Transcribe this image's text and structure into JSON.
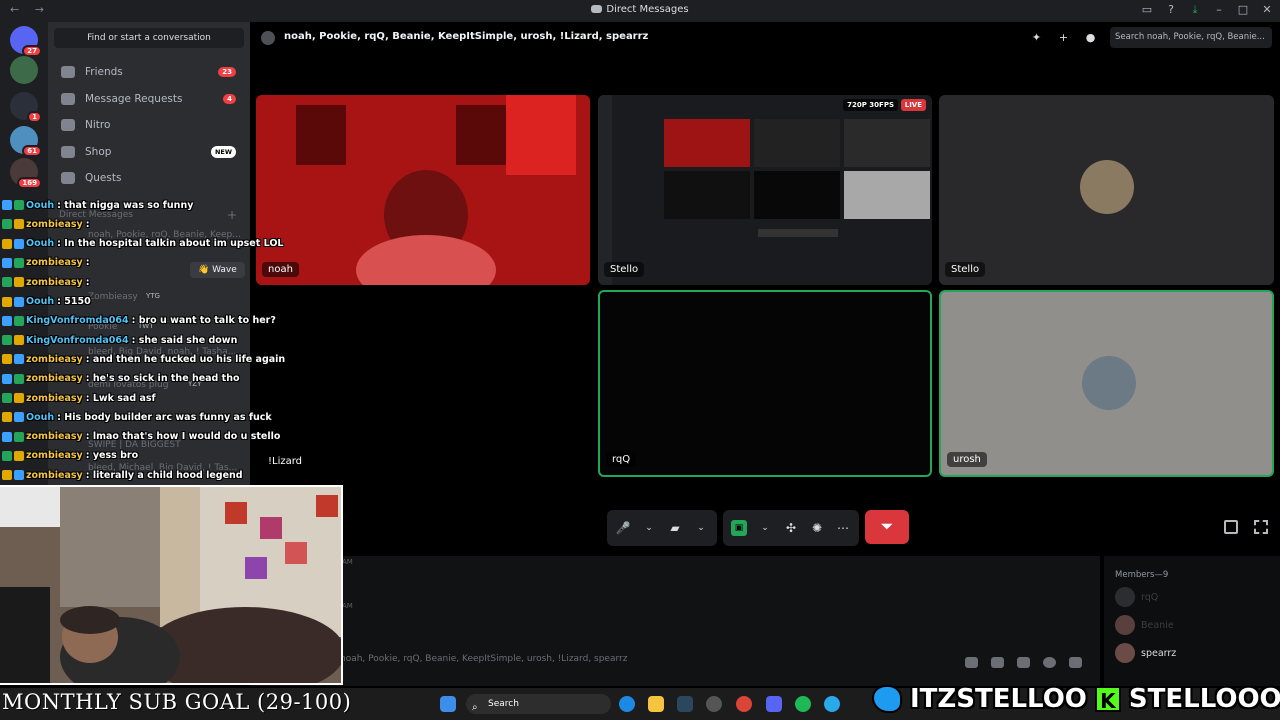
{
  "window": {
    "title": "Direct Messages"
  },
  "rail": {
    "servers": [
      {
        "name": "direct-messages",
        "badge": "27",
        "color": "#5865f2"
      },
      {
        "name": "server-2",
        "badge": "",
        "color": "#3d6b4a"
      },
      {
        "name": "server-3",
        "badge": "1",
        "color": "#2a2f3a"
      },
      {
        "name": "server-4",
        "badge": "61",
        "color": "#4e8fbf"
      },
      {
        "name": "server-5",
        "badge": "169",
        "color": "#4a3a3a"
      }
    ]
  },
  "sidebar": {
    "search_label": "Find or start a conversation",
    "nav": [
      {
        "label": "Friends",
        "count": "23",
        "pill": ""
      },
      {
        "label": "Message Requests",
        "count": "4",
        "pill": ""
      },
      {
        "label": "Nitro",
        "count": "",
        "pill": ""
      },
      {
        "label": "Shop",
        "count": "",
        "pill": "NEW"
      },
      {
        "label": "Quests",
        "count": "",
        "pill": ""
      }
    ],
    "faint": {
      "dm_header": "Direct Messages",
      "dm_group": "noah, Pookie, rqQ, Beanie, Keep...",
      "wave": "👋 Wave",
      "zombieasy": "Zombieasy",
      "zombie_tag": "YTG",
      "pookie": "Pookie",
      "pookie_tag": "TWT",
      "group2": "bleed, Big David, noah, ! Tasha...",
      "plug": "demi lovatos plug",
      "plug_tag": "YZY",
      "swipe": "SWIPE | DA BIGGEST",
      "group3": "bleed, Michael, Big David, ! Tas..."
    }
  },
  "chat": {
    "messages": [
      {
        "user": "Oouh",
        "text": ": that nigga was so funny",
        "color": "#4fc3f7"
      },
      {
        "user": "zombieasy",
        "text": ":",
        "color": "#f5c542"
      },
      {
        "user": "Oouh",
        "text": ": In the hospital talkin about im upset LOL",
        "color": "#4fc3f7"
      },
      {
        "user": "zombieasy",
        "text": ":",
        "color": "#f5c542"
      },
      {
        "user": "zombieasy",
        "text": ":",
        "color": "#f5c542"
      },
      {
        "user": "Oouh",
        "text": ": 5150",
        "color": "#4fc3f7"
      },
      {
        "user": "KingVonfromda064",
        "text": ": bro u want to talk to her?",
        "color": "#4fc3f7"
      },
      {
        "user": "KingVonfromda064",
        "text": ": she said she down",
        "color": "#4fc3f7"
      },
      {
        "user": "zombieasy",
        "text": ": and then he fucked uo his life again",
        "color": "#f5c542"
      },
      {
        "user": "zombieasy",
        "text": ": he's so sick in the head tho",
        "color": "#f5c542"
      },
      {
        "user": "zombieasy",
        "text": ": Lwk sad asf",
        "color": "#f5c542"
      },
      {
        "user": "Oouh",
        "text": ": His body builder arc was funny as fuck",
        "color": "#4fc3f7"
      },
      {
        "user": "zombieasy",
        "text": ": lmao that's how I would do u stello",
        "color": "#f5c542"
      },
      {
        "user": "zombieasy",
        "text": ": yess bro",
        "color": "#f5c542"
      },
      {
        "user": "zombieasy",
        "text": ": literally a child hood legend",
        "color": "#f5c542"
      }
    ]
  },
  "header": {
    "participants": "noah, Pookie, rqQ, Beanie, KeepItSimple, urosh, !Lizard, spearrz",
    "search_placeholder": "Search noah, Pookie, rqQ, Beanie..."
  },
  "tiles": [
    {
      "name": "noah",
      "bg": "#a81414"
    },
    {
      "name": "Stello",
      "bg": "#1a1b1e",
      "badge_quality": "720P 30FPS",
      "badge_live": "LIVE"
    },
    {
      "name": "Stello",
      "bg": "#29292b"
    },
    {
      "name": "!Lizard",
      "bg": "#000000"
    },
    {
      "name": "rqQ",
      "bg": "#050505"
    },
    {
      "name": "urosh",
      "bg": "#918f8b"
    }
  ],
  "lowchat": {
    "ts1": "AM",
    "ts2": "AM",
    "input_placeholder": "noah, Pookie, rqQ, Beanie, KeepItSimple, urosh, !Lizard, spearrz"
  },
  "members": {
    "header": "Members—9",
    "items": [
      {
        "name": "rqQ",
        "dim": true
      },
      {
        "name": "Beanie",
        "dim": true
      },
      {
        "name": "spearrz",
        "dim": false
      }
    ]
  },
  "overlay": {
    "sub_goal": "MONTHLY SUB GOAL (29-100)",
    "twitter": "ITZSTELLOO",
    "kick_logo": "K",
    "kick": "STELLOOO"
  },
  "taskbar": {
    "search_label": "Search"
  }
}
